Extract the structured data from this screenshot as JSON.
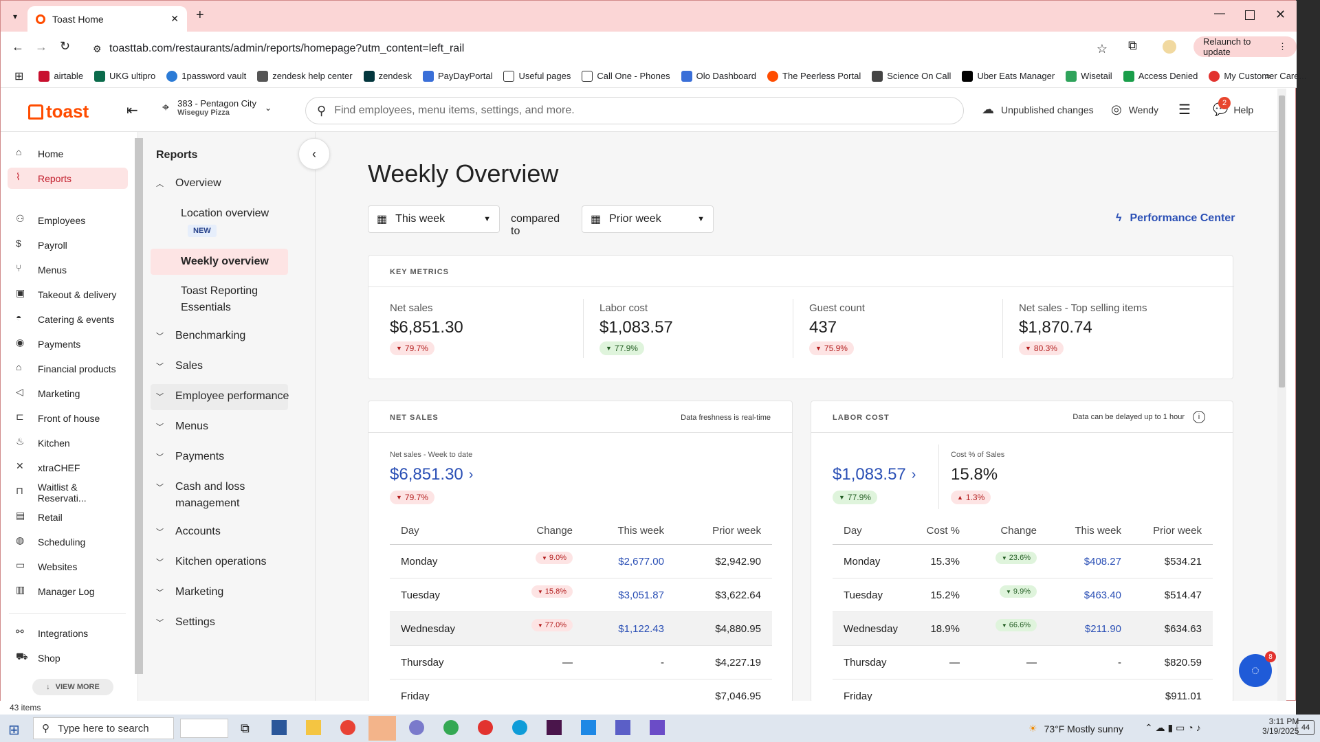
{
  "browser": {
    "tab_title": "Toast Home",
    "url": "toasttab.com/restaurants/admin/reports/homepage?utm_content=left_rail",
    "relaunch": "Relaunch to update",
    "bookmarks": [
      "airtable",
      "UKG ultipro",
      "1password vault",
      "zendesk help center",
      "zendesk",
      "PayDayPortal",
      "Useful pages",
      "Call One - Phones",
      "Olo Dashboard",
      "The Peerless Portal",
      "Science On Call",
      "Uber Eats Manager",
      "Wisetail",
      "Access Denied",
      "My Customer Care..."
    ],
    "status": "43 items"
  },
  "topbar": {
    "logo": "toast",
    "location_name": "383 - Pentagon City",
    "location_sub": "Wiseguy Pizza",
    "search_placeholder": "Find employees, menu items, settings, and more.",
    "unpublished": "Unpublished changes",
    "user": "Wendy",
    "help": "Help",
    "help_badge": "2"
  },
  "leftnav": {
    "items": [
      "Home",
      "Reports",
      "Employees",
      "Payroll",
      "Menus",
      "Takeout & delivery",
      "Catering & events",
      "Payments",
      "Financial products",
      "Marketing",
      "Front of house",
      "Kitchen",
      "xtraCHEF",
      "Waitlist & Reservati...",
      "Retail",
      "Scheduling",
      "Websites",
      "Manager Log",
      "Integrations",
      "Shop"
    ],
    "view_more": "VIEW MORE"
  },
  "subnav": {
    "title": "Reports",
    "overview": "Overview",
    "location_overview": "Location overview",
    "new_badge": "NEW",
    "weekly_overview": "Weekly overview",
    "essentials_1": "Toast Reporting",
    "essentials_2": "Essentials",
    "groups": [
      "Benchmarking",
      "Sales",
      "Employee performance",
      "Menus",
      "Payments",
      "Cash and loss",
      "Accounts",
      "Kitchen operations",
      "Marketing",
      "Settings"
    ],
    "cash_line2": "management"
  },
  "page": {
    "title": "Weekly Overview",
    "period": "This week",
    "compared": "compared to",
    "compare_period": "Prior week",
    "performance_center": "Performance Center"
  },
  "key_metrics": {
    "title": "KEY METRICS",
    "items": [
      {
        "label": "Net sales",
        "value": "$6,851.30",
        "change": "79.7%",
        "dir": "down",
        "tone": "red"
      },
      {
        "label": "Labor cost",
        "value": "$1,083.57",
        "change": "77.9%",
        "dir": "down",
        "tone": "grn"
      },
      {
        "label": "Guest count",
        "value": "437",
        "change": "75.9%",
        "dir": "down",
        "tone": "red"
      },
      {
        "label": "Net sales - Top selling items",
        "value": "$1,870.74",
        "change": "80.3%",
        "dir": "down",
        "tone": "red"
      }
    ]
  },
  "net_sales": {
    "title": "NET SALES",
    "freshness": "Data freshness is real-time",
    "wtd_label": "Net sales - Week to date",
    "wtd_value": "$6,851.30",
    "wtd_change": "79.7%",
    "headers": [
      "Day",
      "Change",
      "This week",
      "Prior week"
    ],
    "rows": [
      {
        "day": "Monday",
        "change": "9.0%",
        "this": "$2,677.00",
        "prior": "$2,942.90"
      },
      {
        "day": "Tuesday",
        "change": "15.8%",
        "this": "$3,051.87",
        "prior": "$3,622.64"
      },
      {
        "day": "Wednesday",
        "change": "77.0%",
        "this": "$1,122.43",
        "prior": "$4,880.95"
      },
      {
        "day": "Thursday",
        "change": "—",
        "this": "-",
        "prior": "$4,227.19"
      },
      {
        "day": "Friday",
        "change": "",
        "this": "",
        "prior": "$7,046.95"
      }
    ]
  },
  "labor_cost": {
    "title": "LABOR COST",
    "freshness": "Data can be delayed up to 1 hour",
    "value": "$1,083.57",
    "change": "77.9%",
    "pct_label": "Cost % of Sales",
    "pct_value": "15.8%",
    "pct_change": "1.3%",
    "headers": [
      "Day",
      "Cost %",
      "Change",
      "This week",
      "Prior week"
    ],
    "rows": [
      {
        "day": "Monday",
        "cost": "15.3%",
        "change": "23.6%",
        "this": "$408.27",
        "prior": "$534.21"
      },
      {
        "day": "Tuesday",
        "cost": "15.2%",
        "change": "9.9%",
        "this": "$463.40",
        "prior": "$514.47"
      },
      {
        "day": "Wednesday",
        "cost": "18.9%",
        "change": "66.6%",
        "this": "$211.90",
        "prior": "$634.63"
      },
      {
        "day": "Thursday",
        "cost": "—",
        "change": "—",
        "this": "-",
        "prior": "$820.59"
      },
      {
        "day": "Friday",
        "cost": "",
        "change": "",
        "this": "",
        "prior": "$911.01"
      }
    ]
  },
  "chat_badge": "8",
  "taskbar": {
    "search": "Type here to search",
    "weather": "73°F  Mostly sunny",
    "time": "3:11 PM",
    "date": "3/19/2025",
    "notif": "44"
  }
}
